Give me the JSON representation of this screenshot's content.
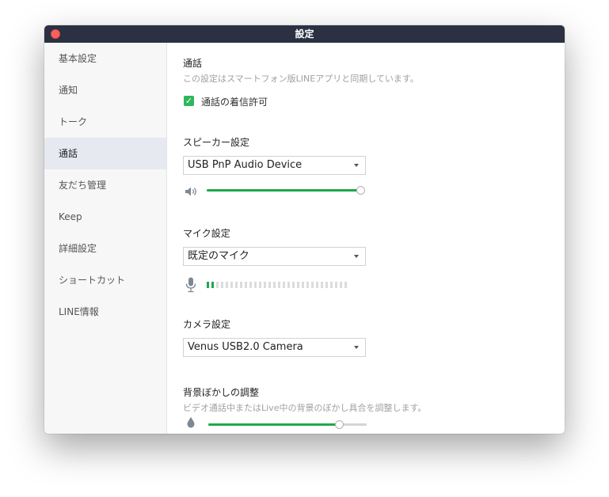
{
  "window": {
    "title": "設定"
  },
  "sidebar": {
    "items": [
      {
        "label": "基本設定",
        "active": false
      },
      {
        "label": "通知",
        "active": false
      },
      {
        "label": "トーク",
        "active": false
      },
      {
        "label": "通話",
        "active": true
      },
      {
        "label": "友だち管理",
        "active": false
      },
      {
        "label": "Keep",
        "active": false
      },
      {
        "label": "詳細設定",
        "active": false
      },
      {
        "label": "ショートカット",
        "active": false
      },
      {
        "label": "LINE情報",
        "active": false
      }
    ]
  },
  "call": {
    "title": "通話",
    "description": "この設定はスマートフォン版LINEアプリと同期しています。",
    "allow_incoming": {
      "label": "通話の着信許可",
      "checked": true
    }
  },
  "speaker": {
    "title": "スピーカー設定",
    "device": "USB PnP Audio Device",
    "volume_percent": 100
  },
  "mic": {
    "title": "マイク設定",
    "device": "既定のマイク",
    "level_segments_total": 30,
    "level_segments_active": 2
  },
  "camera": {
    "title": "カメラ設定",
    "device": "Venus USB2.0 Camera"
  },
  "blur": {
    "title": "背景ぼかしの調整",
    "description": "ビデオ通話中またはLive中の背景のぼかし具合を調整します。",
    "level_percent": 83
  },
  "colors": {
    "accent": "#1fa84d",
    "titlebar": "#2b3142",
    "close": "#fc605c"
  }
}
